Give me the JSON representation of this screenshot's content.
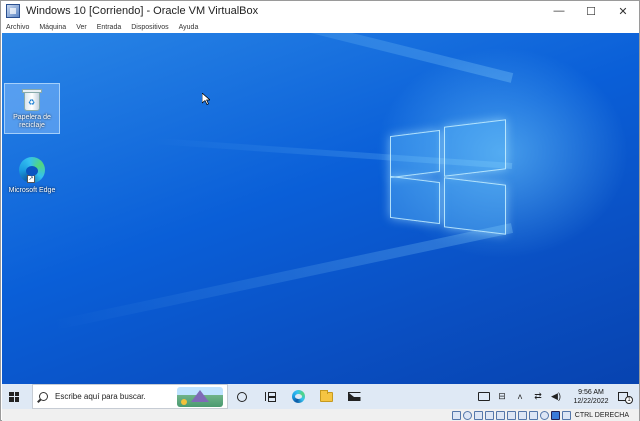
{
  "window": {
    "title": "Windows 10 [Corriendo] - Oracle VM VirtualBox",
    "controls": {
      "minimize": "—",
      "maximize": "☐",
      "close": "✕"
    }
  },
  "menu": [
    "Archivo",
    "Máquina",
    "Ver",
    "Entrada",
    "Dispositivos",
    "Ayuda"
  ],
  "desktop": {
    "icons": [
      {
        "label": "Papelera de reciclaje",
        "icon": "recycle-bin-icon",
        "selected": true
      },
      {
        "label": "Microsoft Edge",
        "icon": "edge-icon",
        "selected": false
      }
    ]
  },
  "taskbar": {
    "search_placeholder": "Escribe aquí para buscar.",
    "pinned": [
      "cortana-icon",
      "task-view-icon",
      "edge-icon",
      "file-explorer-icon",
      "mail-icon"
    ],
    "clock": {
      "time": "9:56 AM",
      "date": "12/22/2022"
    },
    "notifications_count": "1"
  },
  "statusbar": {
    "host_key": "CTRL DERECHA"
  },
  "colors": {
    "desktop_blue": "#0a5fd8",
    "taskbar": "#dfe9f5"
  }
}
